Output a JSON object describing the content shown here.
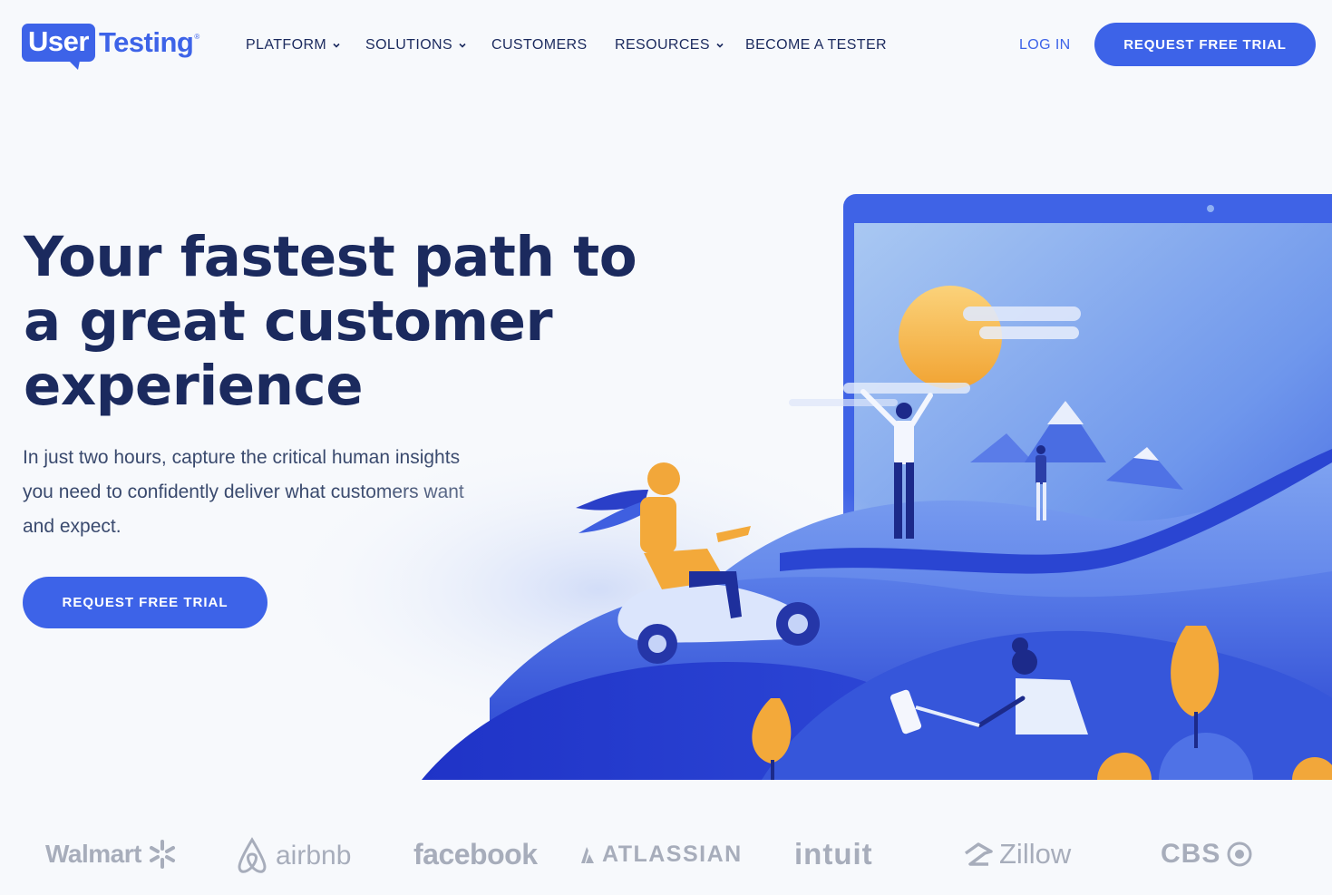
{
  "logo": {
    "part1": "User",
    "part2": "Testing",
    "mark": "®"
  },
  "nav": {
    "items": [
      {
        "label": "PLATFORM",
        "dropdown": true
      },
      {
        "label": "SOLUTIONS",
        "dropdown": true
      },
      {
        "label": "CUSTOMERS",
        "dropdown": false
      },
      {
        "label": "RESOURCES",
        "dropdown": true
      },
      {
        "label": "BECOME A TESTER",
        "dropdown": false
      }
    ],
    "login": "LOG IN",
    "cta": "REQUEST FREE TRIAL"
  },
  "hero": {
    "title_lines": [
      "Your fastest path to",
      "a great customer",
      "experience"
    ],
    "subtitle_lines": [
      "In just two hours, capture the critical human insights",
      "you need to confidently deliver what customers want",
      "and expect."
    ],
    "cta": "REQUEST FREE TRIAL"
  },
  "customer_logos": [
    "Walmart",
    "airbnb",
    "facebook",
    "ATLASSIAN",
    "intuit",
    "Zillow",
    "CBS"
  ],
  "colors": {
    "brand_blue": "#3d63e8",
    "navy_text": "#1b2a5e",
    "logo_gray": "#a7adbb",
    "accent_orange": "#f3a93a"
  }
}
